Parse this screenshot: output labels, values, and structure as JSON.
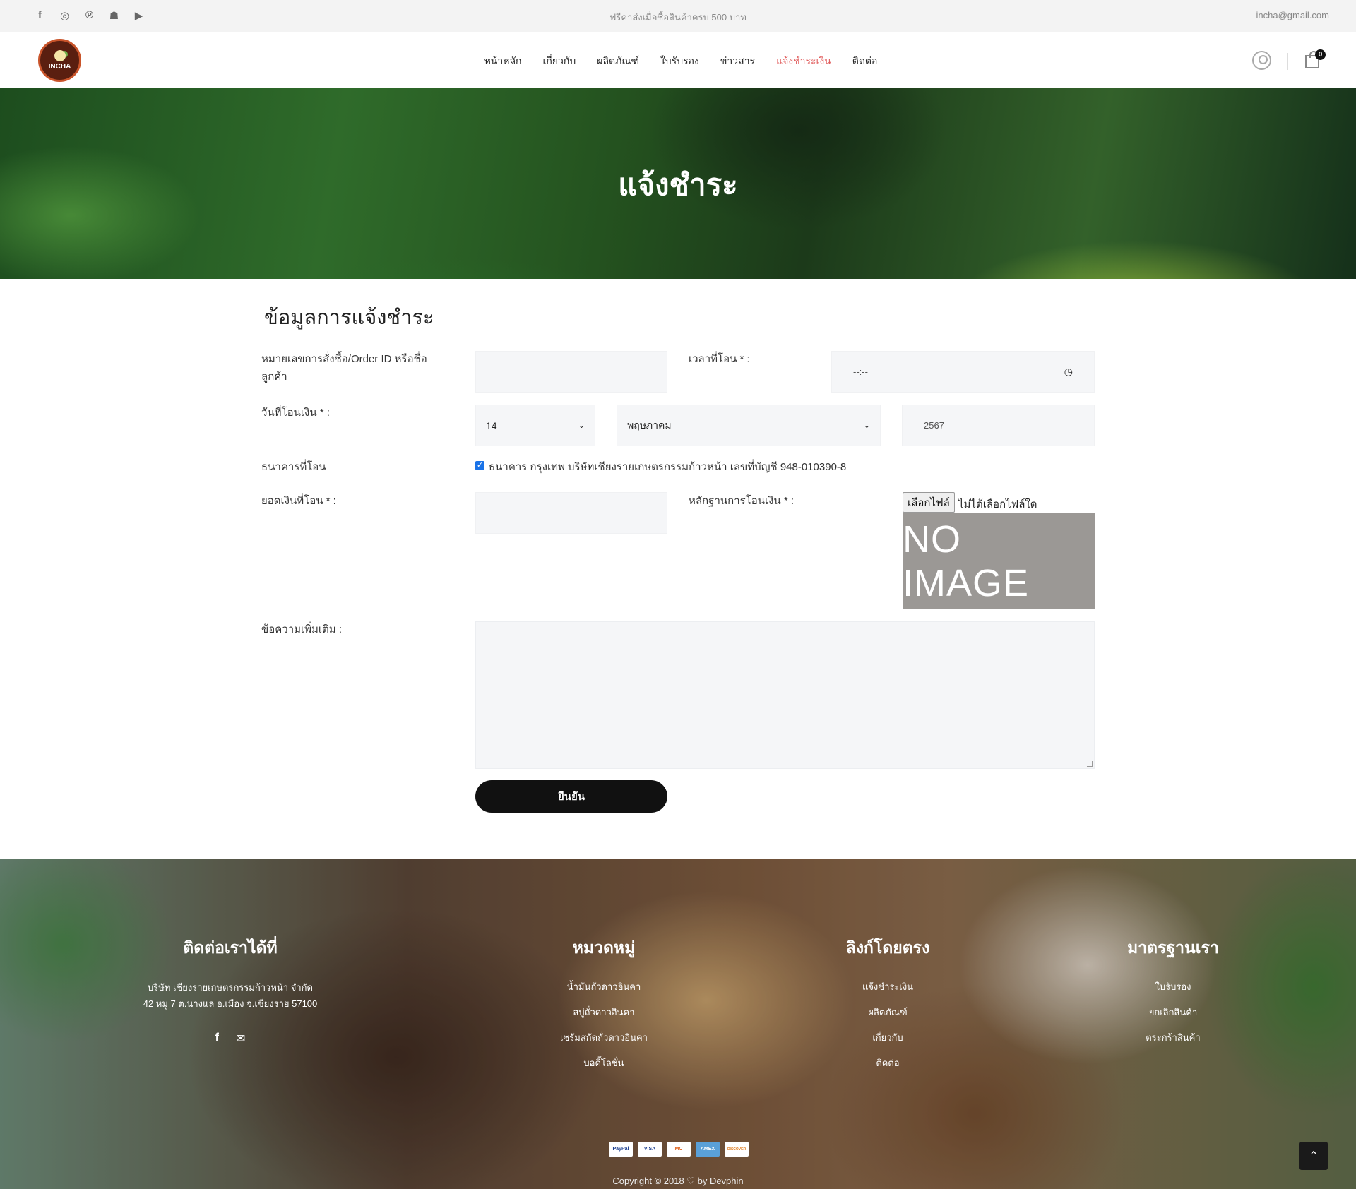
{
  "topbar": {
    "social_icons": [
      "facebook-icon",
      "instagram-icon",
      "pinterest-icon",
      "snapchat-icon",
      "youtube-icon"
    ],
    "promo": "ฟรีค่าส่งเมื่อซื้อสินค้าครบ 500 บาท",
    "email": "incha@gmail.com"
  },
  "header": {
    "logo_text": "INCHA",
    "nav": [
      "หน้าหลัก",
      "เกี่ยวกับ",
      "ผลิตภัณฑ์",
      "ใบรับรอง",
      "ข่าวสาร",
      "แจ้งชำระเงิน",
      "ติดต่อ"
    ],
    "active_nav": "แจ้งชำระเงิน",
    "cart_count": "0"
  },
  "hero": {
    "title": "แจ้งชำระ"
  },
  "form": {
    "title": "ข้อมูลการแจ้งชำระ",
    "order_label_line1": "หมายเลขการสั่งซื้อ/Order ID หรือชื่อ",
    "order_label_line2": "ลูกค้า",
    "order_value": "",
    "time_label": "เวลาที่โอน * :",
    "time_placeholder": "--:--",
    "date_label": "วันที่โอนเงิน * :",
    "day_value": "14",
    "month_value": "พฤษภาคม",
    "year_value": "2567",
    "bank_label": "ธนาคารที่โอน",
    "bank_option": "ธนาคาร กรุงเทพ บริษัทเชียงรายเกษตรกรรมก้าวหน้า เลขที่บัญชี 948-010390-8",
    "bank_checked": true,
    "amount_label": "ยอดเงินที่โอน * :",
    "amount_value": "",
    "proof_label": "หลักฐานการโอนเงิน * :",
    "file_button": "เลือกไฟล์",
    "file_status": "ไม่ได้เลือกไฟล์ใด",
    "no_image": "NO IMAGE",
    "message_label": "ข้อความเพิ่มเติม :",
    "message_value": "",
    "submit": "ยืนยัน"
  },
  "footer": {
    "contact": {
      "title": "ติดต่อเราได้ที่",
      "address_line1": "บริษัท เชียงรายเกษตรกรรมก้าวหน้า จำกัด",
      "address_line2": "42 หมู่ 7 ต.นางแล อ.เมือง จ.เชียงราย 57100"
    },
    "categories": {
      "title": "หมวดหมู่",
      "items": [
        "น้ำมันถั่วดาวอินคา",
        "สบู่ถั่วดาวอินคา",
        "เซรั่มสกัดถั่วดาวอินคา",
        "บอดี้โลชั่น"
      ]
    },
    "links": {
      "title": "ลิงก์โดยตรง",
      "items": [
        "แจ้งชำระเงิน",
        "ผลิตภัณฑ์",
        "เกี่ยวกับ",
        "ติดต่อ"
      ]
    },
    "standards": {
      "title": "มาตรฐานเรา",
      "items": [
        "ใบรับรอง",
        "ยกเลิกสินค้า",
        "ตระกร้าสินค้า"
      ]
    },
    "payments": [
      "PayPal",
      "VISA",
      "MC",
      "AMEX",
      "DISCOVER"
    ],
    "copyright": "Copyright © 2018 ♡ by Devphin"
  }
}
